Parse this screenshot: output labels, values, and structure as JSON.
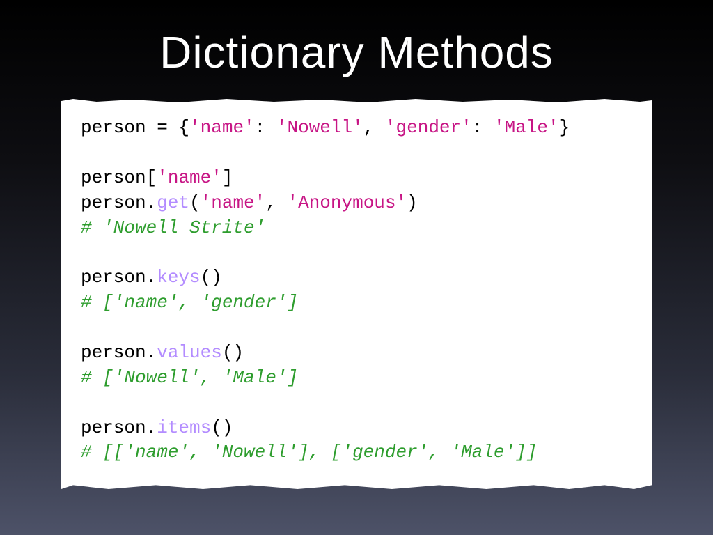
{
  "title": "Dictionary Methods",
  "code": {
    "l1a": "person = {",
    "l1s1": "'name'",
    "l1b": ": ",
    "l1s2": "'Nowell'",
    "l1c": ", ",
    "l1s3": "'gender'",
    "l1d": ": ",
    "l1s4": "'Male'",
    "l1e": "}",
    "l3a": "person[",
    "l3s": "'name'",
    "l3b": "]",
    "l4a": "person.",
    "l4f": "get",
    "l4b": "(",
    "l4s1": "'name'",
    "l4c": ", ",
    "l4s2": "'Anonymous'",
    "l4d": ")",
    "l5": "# 'Nowell Strite'",
    "l7a": "person.",
    "l7f": "keys",
    "l7b": "()",
    "l8": "# ['name', 'gender']",
    "l10a": "person.",
    "l10f": "values",
    "l10b": "()",
    "l11": "# ['Nowell', 'Male']",
    "l13a": "person.",
    "l13f": "items",
    "l13b": "()",
    "l14": "# [['name', 'Nowell'], ['gender', 'Male']]"
  }
}
